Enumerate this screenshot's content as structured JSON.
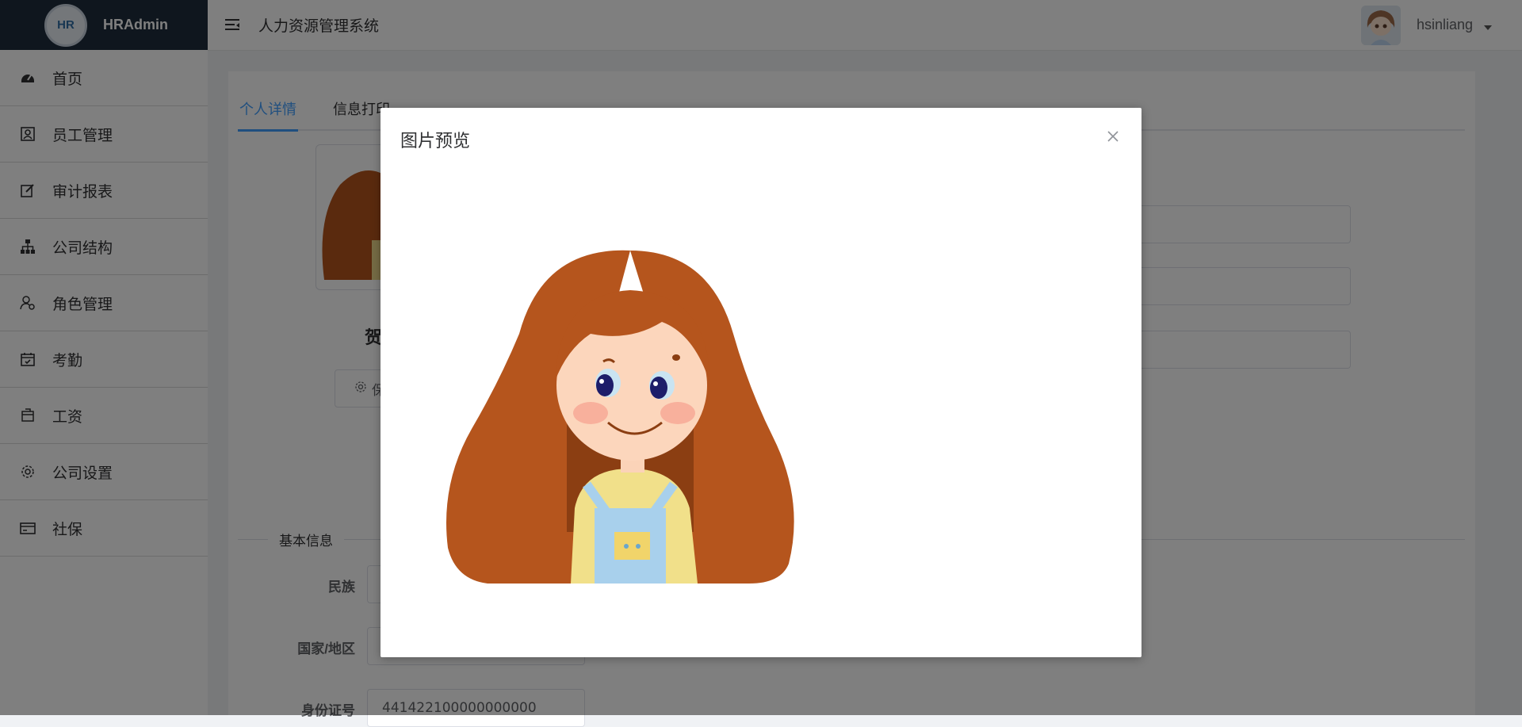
{
  "app": {
    "logo_mark": "HR",
    "logo_text": "HRAdmin",
    "title": "人力资源管理系统"
  },
  "sidebar": {
    "items": [
      {
        "label": "首页",
        "icon": "dashboard-icon"
      },
      {
        "label": "员工管理",
        "icon": "employee-card-icon"
      },
      {
        "label": "审计报表",
        "icon": "edit-report-icon"
      },
      {
        "label": "公司结构",
        "icon": "org-tree-icon"
      },
      {
        "label": "角色管理",
        "icon": "user-role-icon"
      },
      {
        "label": "考勤",
        "icon": "calendar-check-icon"
      },
      {
        "label": "工资",
        "icon": "wallet-icon"
      },
      {
        "label": "公司设置",
        "icon": "gear-icon"
      },
      {
        "label": "社保",
        "icon": "card-icon"
      }
    ]
  },
  "header": {
    "username": "hsinliang"
  },
  "main": {
    "tabs": [
      {
        "label": "个人详情",
        "active": true
      },
      {
        "label": "信息打印",
        "active": false
      }
    ],
    "name_partial": "贺",
    "save_button_partial": "保",
    "section_label": "基本信息",
    "fields": [
      {
        "label": "民族",
        "value": ""
      },
      {
        "label": "国家/地区",
        "value": ""
      },
      {
        "label": "身份证号",
        "value": "441422100000000000"
      }
    ]
  },
  "dialog": {
    "title": "图片预览",
    "close_icon": "close-icon"
  },
  "colors": {
    "accent": "#409eff",
    "sidebar_header": "#1f2d3d",
    "hair": "#b5551d"
  }
}
